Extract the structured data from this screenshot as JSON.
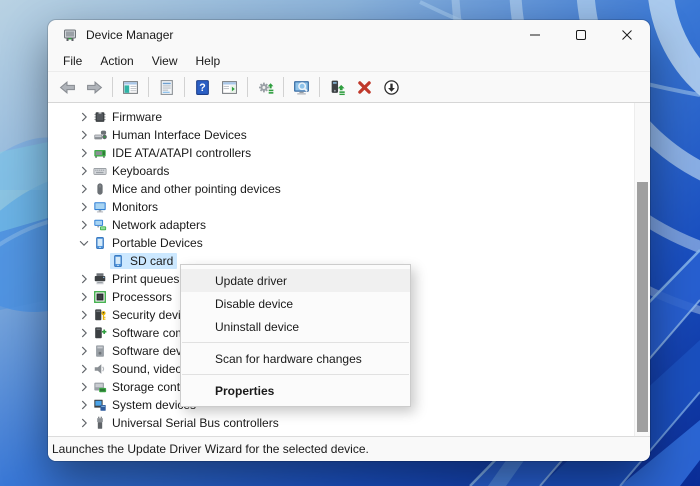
{
  "window": {
    "title": "Device Manager",
    "title_icon": "device-manager-icon",
    "controls": [
      {
        "icon": "minimize-icon",
        "name": "minimize-button"
      },
      {
        "icon": "maximize-icon",
        "name": "maximize-button"
      },
      {
        "icon": "close-icon",
        "name": "close-button"
      }
    ]
  },
  "menu_bar": {
    "items": [
      "File",
      "Action",
      "View",
      "Help"
    ]
  },
  "toolbar": {
    "buttons": [
      {
        "icon": "back-arrow-icon"
      },
      {
        "icon": "forward-arrow-icon"
      },
      {
        "separator": true
      },
      {
        "icon": "show-console-tree-icon"
      },
      {
        "separator": true
      },
      {
        "icon": "properties-icon"
      },
      {
        "separator": true
      },
      {
        "icon": "help-icon"
      },
      {
        "icon": "action-pane-icon"
      },
      {
        "separator": true
      },
      {
        "icon": "update-driver-software-icon"
      },
      {
        "separator": true
      },
      {
        "icon": "scan-hardware-changes-icon"
      },
      {
        "separator": true
      },
      {
        "icon": "update-driver-icon"
      },
      {
        "icon": "uninstall-device-icon"
      },
      {
        "icon": "disable-device-icon"
      }
    ]
  },
  "tree": {
    "items": [
      {
        "label": "Firmware",
        "icon": "firmware-icon",
        "chevron": "collapsed",
        "level": 0
      },
      {
        "label": "Human Interface Devices",
        "icon": "hid-icon",
        "chevron": "collapsed",
        "level": 0
      },
      {
        "label": "IDE ATA/ATAPI controllers",
        "icon": "ide-controller-icon",
        "chevron": "collapsed",
        "level": 0
      },
      {
        "label": "Keyboards",
        "icon": "keyboard-icon",
        "chevron": "collapsed",
        "level": 0
      },
      {
        "label": "Mice and other pointing devices",
        "icon": "mouse-icon",
        "chevron": "collapsed",
        "level": 0
      },
      {
        "label": "Monitors",
        "icon": "monitor-icon",
        "chevron": "collapsed",
        "level": 0
      },
      {
        "label": "Network adapters",
        "icon": "network-adapter-icon",
        "chevron": "collapsed",
        "level": 0
      },
      {
        "label": "Portable Devices",
        "icon": "portable-device-icon",
        "chevron": "expanded",
        "level": 0
      },
      {
        "label": "SD card",
        "icon": "portable-device-icon",
        "chevron": "none",
        "level": 1,
        "selected": true
      },
      {
        "label": "Print queues",
        "icon": "printer-icon",
        "chevron": "collapsed",
        "level": 0
      },
      {
        "label": "Processors",
        "icon": "processor-icon",
        "chevron": "collapsed",
        "level": 0
      },
      {
        "label": "Security devices",
        "icon": "security-device-icon",
        "chevron": "collapsed",
        "level": 0
      },
      {
        "label": "Software components",
        "icon": "software-component-icon",
        "chevron": "collapsed",
        "level": 0
      },
      {
        "label": "Software devices",
        "icon": "software-device-icon",
        "chevron": "collapsed",
        "level": 0
      },
      {
        "label": "Sound, video and game controllers",
        "icon": "sound-icon",
        "chevron": "collapsed",
        "level": 0
      },
      {
        "label": "Storage controllers",
        "icon": "storage-controller-icon",
        "chevron": "collapsed",
        "level": 0
      },
      {
        "label": "System devices",
        "icon": "system-device-icon",
        "chevron": "collapsed",
        "level": 0
      },
      {
        "label": "Universal Serial Bus controllers",
        "icon": "usb-controller-icon",
        "chevron": "collapsed",
        "level": 0
      }
    ]
  },
  "context_menu": {
    "items": [
      {
        "label": "Update driver",
        "highlighted": true
      },
      {
        "label": "Disable device"
      },
      {
        "label": "Uninstall device"
      },
      {
        "separator": true
      },
      {
        "label": "Scan for hardware changes"
      },
      {
        "separator": true
      },
      {
        "label": "Properties",
        "bold": true
      }
    ]
  },
  "status_bar": {
    "text": "Launches the Update Driver Wizard for the selected device."
  },
  "colors": {
    "selection_highlight": "#cce8ff",
    "menu_item_highlight": "#f0f0f0",
    "uninstall_red": "#c0392b",
    "driver_update_green": "#2f9e3f",
    "wallpaper_light_blue": "#b9d2e3",
    "wallpaper_deep_blue": "#0a2c96"
  }
}
